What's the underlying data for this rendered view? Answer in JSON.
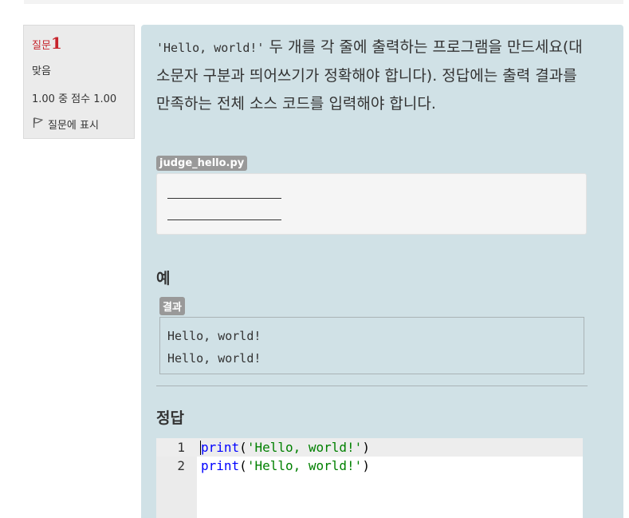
{
  "info": {
    "question_label": "질문",
    "question_number": "1",
    "state": "맞음",
    "grade": "1.00 중 점수 1.00",
    "flag_label": "질문에 표시"
  },
  "question": {
    "code_text": "'Hello, world!'",
    "text": " 두 개를 각 줄에 출력하는 프로그램을 만드세요(대소문자 구분과 띄어쓰기가 정확해야 합니다). 정답에는 출력 결과를 만족하는 전체 소스 코드를 입력해야 합니다."
  },
  "judge": {
    "filename": "judge_hello.py"
  },
  "example": {
    "heading": "예",
    "result_label": "결과",
    "output_lines": [
      "Hello, world!",
      "Hello, world!"
    ]
  },
  "answer": {
    "heading": "정답",
    "lines": [
      {
        "number": "1",
        "func": "print",
        "open": "(",
        "string": "'Hello, world!'",
        "close": ")"
      },
      {
        "number": "2",
        "func": "print",
        "open": "(",
        "string": "'Hello, world!'",
        "close": ")"
      }
    ]
  },
  "colors": {
    "keyword": "#0000ff",
    "string": "#008000",
    "question_number": "#c7242c",
    "content_bg": "#d0e1e6"
  }
}
